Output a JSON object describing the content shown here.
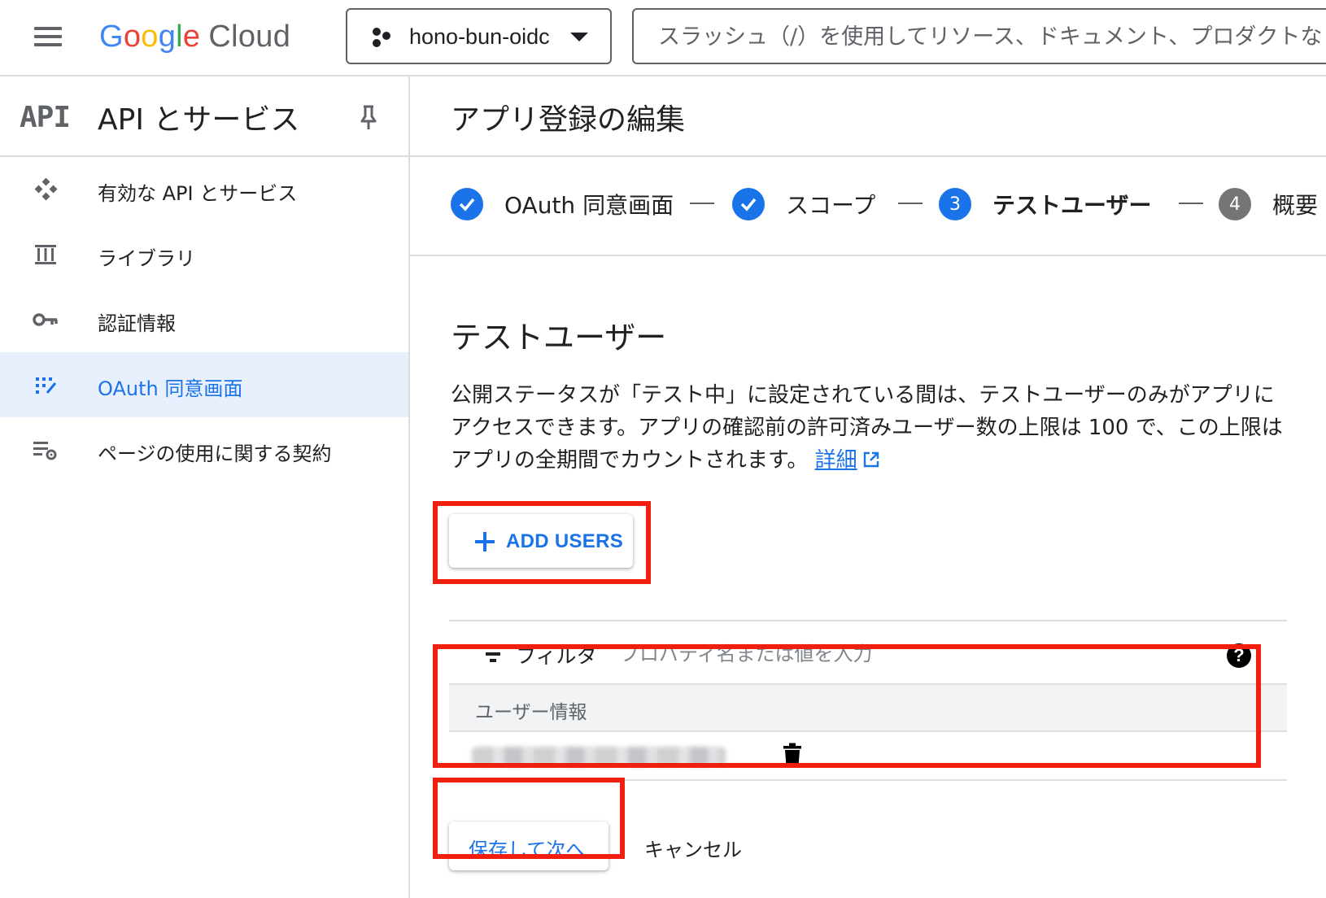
{
  "header": {
    "logo": {
      "g1": "G",
      "o1": "o",
      "o2": "o",
      "g2": "g",
      "l": "l",
      "e": "e",
      "cloud": "Cloud"
    },
    "project_name": "hono-bun-oidc",
    "search_placeholder": "スラッシュ（/）を使用してリソース、ドキュメント、プロダクトなどを検索"
  },
  "sidebar": {
    "logo": "API",
    "title": "API とサービス",
    "items": [
      {
        "label": "有効な API とサービス",
        "icon": "api-diamond-icon",
        "active": false
      },
      {
        "label": "ライブラリ",
        "icon": "library-icon",
        "active": false
      },
      {
        "label": "認証情報",
        "icon": "key-icon",
        "active": false
      },
      {
        "label": "OAuth 同意画面",
        "icon": "oauth-consent-icon",
        "active": true
      },
      {
        "label": "ページの使用に関する契約",
        "icon": "page-usage-settings-icon",
        "active": false
      }
    ]
  },
  "main": {
    "title": "アプリ登録の編集",
    "steps": [
      {
        "label": "OAuth 同意画面",
        "state": "done"
      },
      {
        "label": "スコープ",
        "state": "done"
      },
      {
        "number": "3",
        "label": "テストユーザー",
        "state": "current"
      },
      {
        "number": "4",
        "label": "概要",
        "state": "pending"
      }
    ],
    "section_title": "テストユーザー",
    "description": "公開ステータスが「テスト中」に設定されている間は、テストユーザーのみがアプリにアクセスできます。アプリの確認前の許可済みユーザー数の上限は 100 で、この上限はアプリの全期間でカウントされます。",
    "details_link": "詳細",
    "add_users_label": "ADD USERS",
    "filter": {
      "label": "フィルタ",
      "placeholder": "プロパティ名または値を入力"
    },
    "table": {
      "header": "ユーザー情報"
    },
    "save_label": "保存して次へ",
    "cancel_label": "キャンセル"
  },
  "colors": {
    "accent": "#1a73e8",
    "highlight": "#f01f10",
    "active_bg": "#e8f0fe"
  }
}
